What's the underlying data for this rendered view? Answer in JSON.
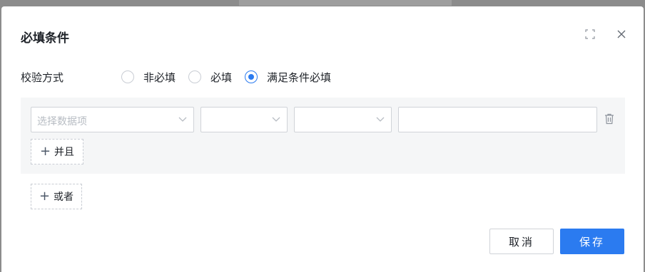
{
  "dialog": {
    "title": "必填条件"
  },
  "validation": {
    "label": "校验方式",
    "options": [
      {
        "label": "非必填",
        "selected": false
      },
      {
        "label": "必填",
        "selected": false
      },
      {
        "label": "满足条件必填",
        "selected": true
      }
    ]
  },
  "condition": {
    "field_placeholder": "选择数据项",
    "operator_value": "",
    "compare_value": "",
    "input_value": ""
  },
  "actions": {
    "and_label": "并且",
    "or_label": "或者",
    "cancel_label": "取消",
    "save_label": "保存"
  },
  "colors": {
    "primary": "#2b7bf0",
    "group_bg": "#f5f6f7"
  }
}
